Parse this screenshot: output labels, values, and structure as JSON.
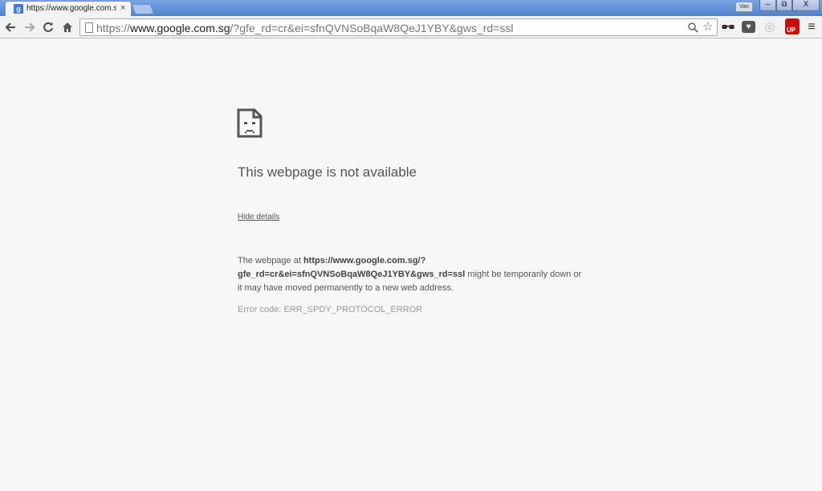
{
  "browser": {
    "tab": {
      "title": "https://www.google.com.sg/",
      "favicon_letter": "g",
      "close_glyph": "×"
    },
    "profile_label": "Van",
    "window_controls": {
      "minimize": "–",
      "maximize": "⧉",
      "close": "X"
    }
  },
  "toolbar": {
    "url_scheme": "https://",
    "url_host": "www.google.com.sg",
    "url_path": "/?gfe_rd=cr&ei=sfnQVNSoBqaW8QeJ1YBY&gws_rd=ssl",
    "icons": [
      "back-arrow-icon",
      "forward-arrow-icon",
      "reload-icon",
      "home-icon",
      "search-icon",
      "star-icon",
      "menu-icon"
    ],
    "extensions": [
      "glasses-icon",
      "pocket-icon",
      "circle-icon",
      "up-icon"
    ],
    "up_label": "UP",
    "pocket_glyph": "♥",
    "circle_glyph": "◎"
  },
  "error": {
    "headline": "This webpage is not available",
    "details_link": "Hide details",
    "desc_prefix": "The webpage at ",
    "desc_url": "https://www.google.com.sg/?gfe_rd=cr&ei=sfnQVNSoBqaW8QeJ1YBY&gws_rd=ssl",
    "desc_suffix": " might be temporarily down or it may have moved permanently to a new web address.",
    "error_code": "Error code: ERR_SPDY_PROTOCOL_ERROR"
  },
  "colors": {
    "titlebar": "#5e8fd6",
    "page_background": "#f7f7f7",
    "text": "#555555",
    "muted_text": "#999999",
    "up_badge": "#c90d0d"
  }
}
